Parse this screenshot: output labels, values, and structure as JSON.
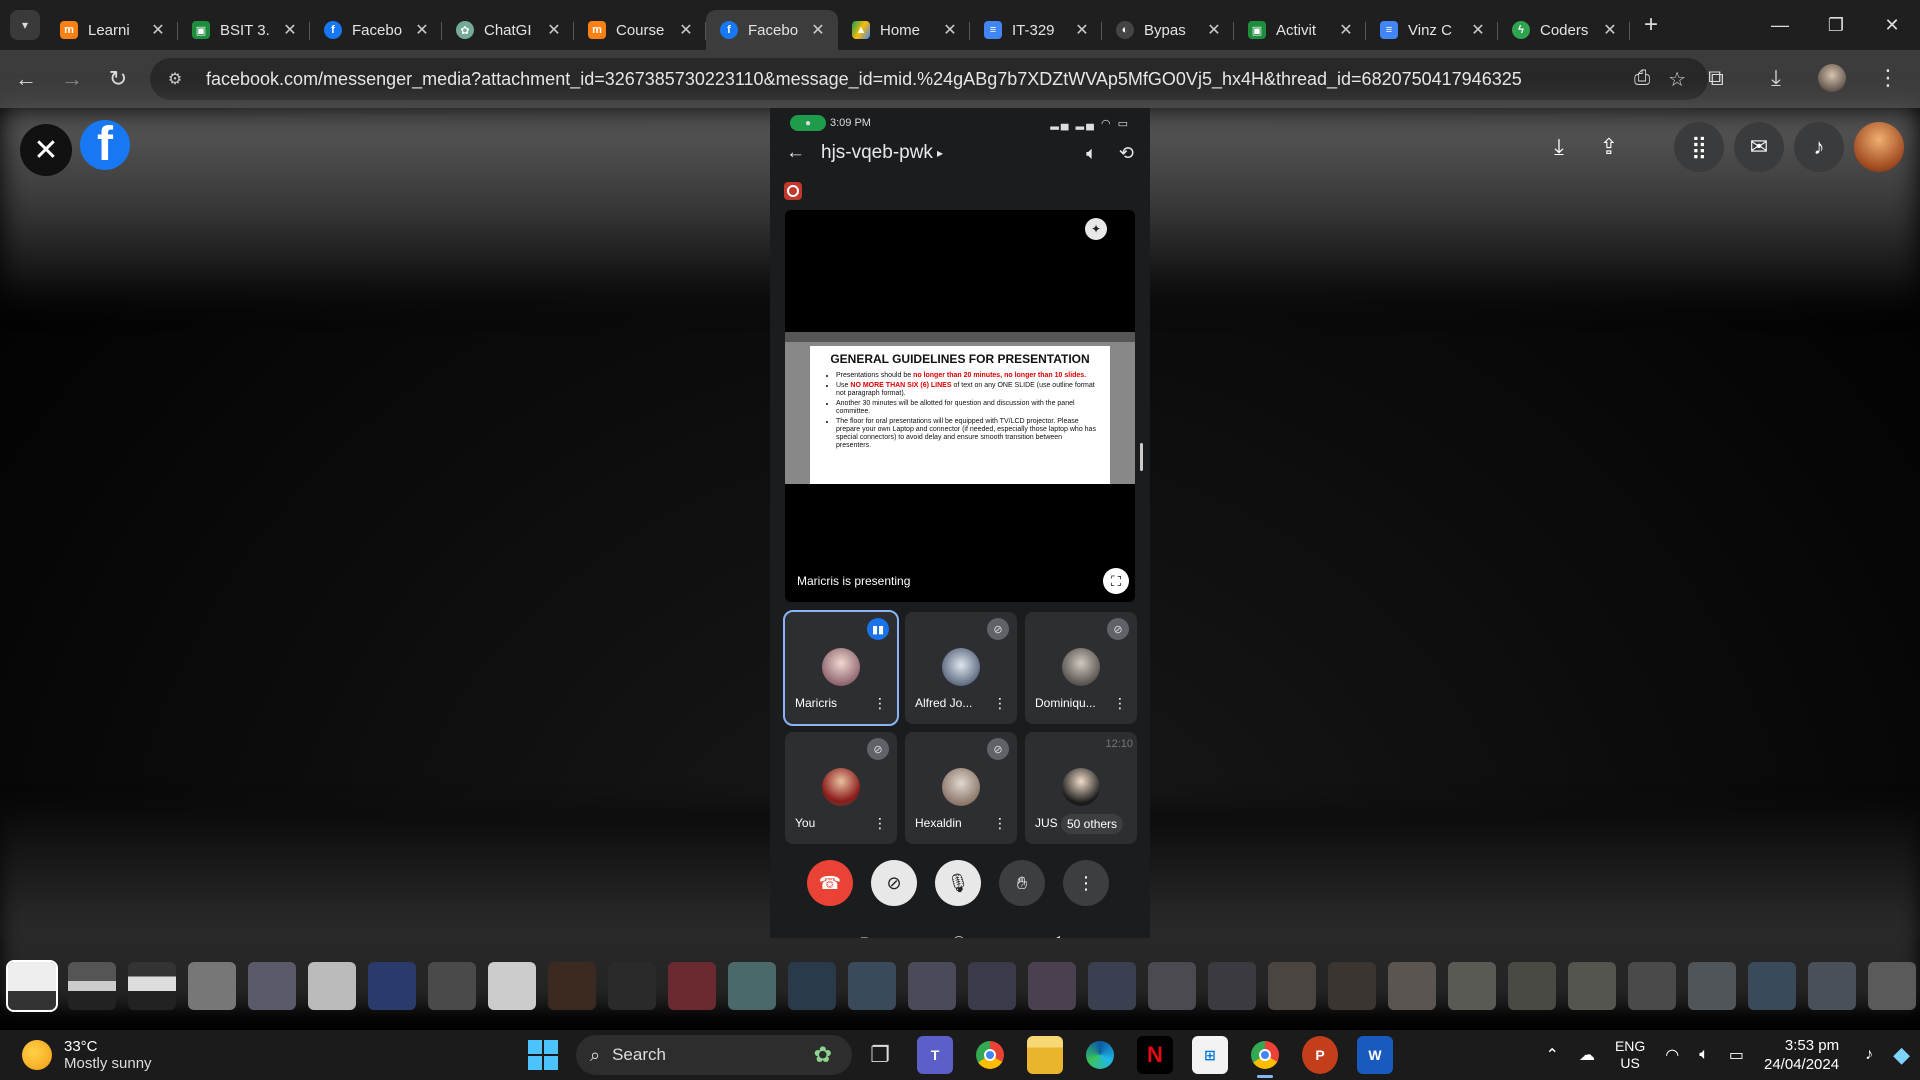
{
  "browser": {
    "tabs": [
      {
        "title": "Learni",
        "icon": "moodle-icon",
        "color": "#f98012"
      },
      {
        "title": "BSIT 3.",
        "icon": "classroom-icon",
        "color": "#1e8e3e"
      },
      {
        "title": "Facebo",
        "icon": "facebook-icon",
        "color": "#1877f2"
      },
      {
        "title": "ChatGI",
        "icon": "chatgpt-icon",
        "color": "#74aa9c"
      },
      {
        "title": "Course",
        "icon": "moodle-icon",
        "color": "#f98012"
      },
      {
        "title": "Facebo",
        "icon": "facebook-icon",
        "color": "#1877f2",
        "active": true
      },
      {
        "title": "Home",
        "icon": "drive-icon",
        "color": "#fbbc04"
      },
      {
        "title": "IT-329",
        "icon": "docs-icon",
        "color": "#4285f4"
      },
      {
        "title": "Bypas",
        "icon": "bypass-icon",
        "color": "#444444"
      },
      {
        "title": "Activit",
        "icon": "classroom-icon",
        "color": "#1e8e3e"
      },
      {
        "title": "Vinz C",
        "icon": "docs-icon",
        "color": "#4285f4"
      },
      {
        "title": "Coders",
        "icon": "coders-icon",
        "color": "#2ea44f"
      }
    ],
    "url": "facebook.com/messenger_media?attachment_id=3267385730223110&message_id=mid.%24gABg7b7XDZtWVAp5MfGO0Vj5_hx4H&thread_id=6820750417946325"
  },
  "meet": {
    "status_time": "3:09 PM",
    "code": "hjs-vqeb-pwk",
    "presenting": "Maricris  is presenting",
    "slide": {
      "title": "GENERAL GUIDELINES FOR PRESENTATION",
      "b1_a": "Presentations should be ",
      "b1_red": "no longer than 20 minutes, no longer than 10 slides.",
      "b2_a": "Use ",
      "b2_red": "NO MORE THAN SIX (6) LINES",
      "b2_b": " of text on any ONE SLIDE (use outline format not paragraph format).",
      "b3": "Another 30 minutes will be allotted for question and discussion with the panel committee.",
      "b4": "The floor for oral presentations will be equipped with TV/LCD projector. Please prepare your own Laptop and connector (if needed, especially those laptop who has special connectors) to avoid delay and ensure smooth transition between presenters."
    },
    "participants": [
      {
        "name": "Maricris",
        "speaking": true
      },
      {
        "name": "Alfred Jo...",
        "speaking": false
      },
      {
        "name": "Dominiqu...",
        "speaking": false
      },
      {
        "name": "You",
        "speaking": false
      },
      {
        "name": "Hexaldin",
        "speaking": false
      },
      {
        "name": "JUS",
        "speaking": false
      }
    ],
    "others": "50 others",
    "ghost_time": "12:10"
  },
  "taskbar": {
    "temp": "33°C",
    "weather": "Mostly sunny",
    "search": "Search",
    "lang1": "ENG",
    "lang2": "US",
    "time": "3:53 pm",
    "date": "24/04/2024"
  }
}
